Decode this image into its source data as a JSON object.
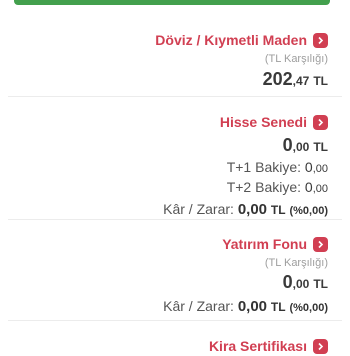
{
  "colors": {
    "accent": "#d13f52",
    "top_bar": "#43a04d",
    "chevron_bg": "#d13f52"
  },
  "doviz": {
    "title": "Döviz / Kıymetli Maden",
    "sub": "(TL Karşılığı)",
    "amount_int": "202",
    "amount_dec": ",47",
    "currency": "TL"
  },
  "hisse": {
    "title": "Hisse Senedi",
    "amount_int": "0",
    "amount_dec": ",00",
    "currency": "TL",
    "t1_label": "T+1 Bakiye: ",
    "t1_int": "0",
    "t1_dec": ",00",
    "t2_label": "T+2 Bakiye: ",
    "t2_int": "0",
    "t2_dec": ",00",
    "kz_label": "Kâr / Zarar: ",
    "kz_value": "0,00",
    "kz_currency": "TL",
    "kz_pct": "(%0,00)"
  },
  "fon": {
    "title": "Yatırım Fonu",
    "sub": "(TL Karşılığı)",
    "amount_int": "0",
    "amount_dec": ",00",
    "currency": "TL",
    "kz_label": "Kâr / Zarar: ",
    "kz_value": "0,00",
    "kz_currency": "TL",
    "kz_pct": "(%0,00)"
  },
  "kira": {
    "title": "Kira Sertifikası"
  }
}
